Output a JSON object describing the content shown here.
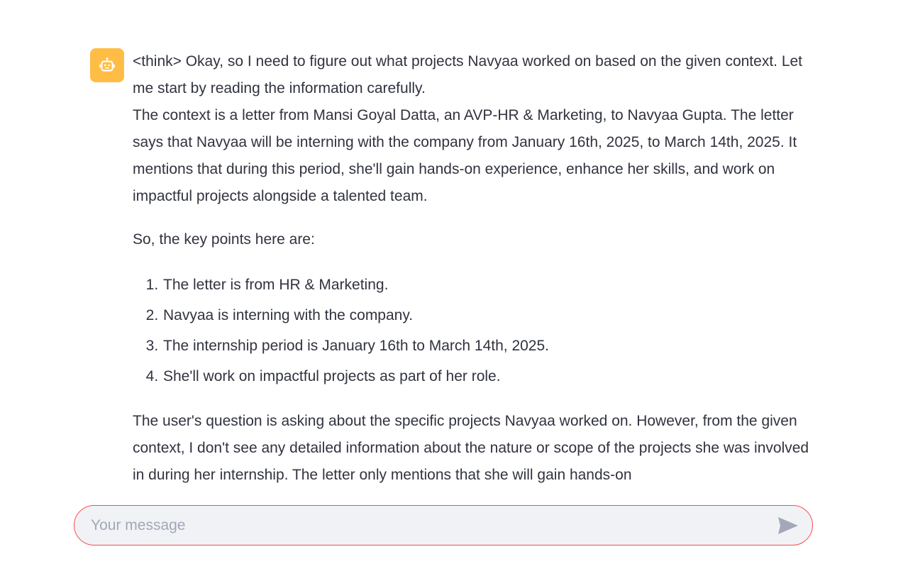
{
  "chat": {
    "assistant_message": {
      "avatar_icon": "robot-icon",
      "avatar_color": "#ffbd45",
      "paragraph_1": "<think> Okay, so I need to figure out what projects Navyaa worked on based on the given context. Let me start by reading the information carefully.",
      "paragraph_2": "The context is a letter from Mansi Goyal Datta, an AVP-HR & Marketing, to Navyaa Gupta. The letter says that Navyaa will be interning with the company from January 16th, 2025, to March 14th, 2025. It mentions that during this period, she'll gain hands-on experience, enhance her skills, and work on impactful projects alongside a talented team.",
      "paragraph_3": "So, the key points here are:",
      "list_items": [
        "The letter is from HR & Marketing.",
        "Navyaa is interning with the company.",
        "The internship period is January 16th to March 14th, 2025.",
        "She'll work on impactful projects as part of her role."
      ],
      "paragraph_4": "The user's question is asking about the specific projects Navyaa worked on. However, from the given context, I don't see any detailed information about the nature or scope of the projects she was involved in during her internship. The letter only mentions that she will gain hands-on"
    },
    "input": {
      "placeholder": "Your message",
      "value": "",
      "border_color": "#ff4b4b"
    },
    "send_icon": "send-icon"
  }
}
